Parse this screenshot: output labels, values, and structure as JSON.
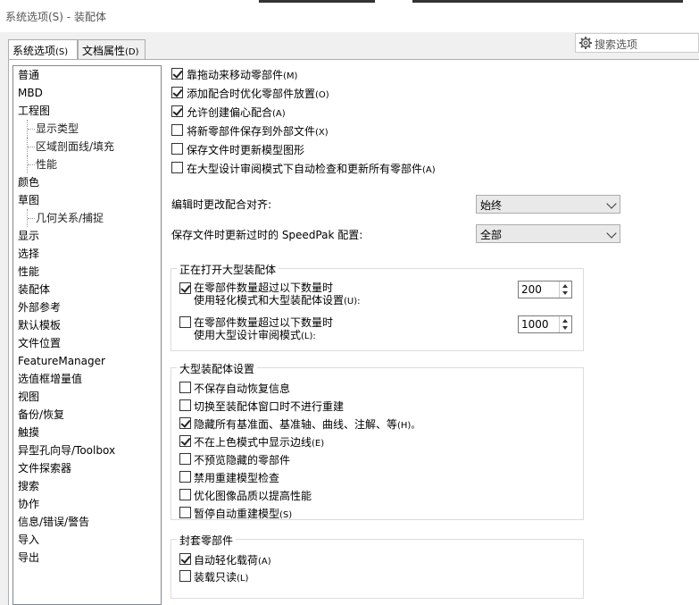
{
  "window": {
    "title": "系统选项(S) - 装配体"
  },
  "search": {
    "placeholder": "搜索选项",
    "icon": "gear-icon"
  },
  "tabs": [
    {
      "label": "系统选项",
      "shortcut": "(S)",
      "active": true
    },
    {
      "label": "文档属性",
      "shortcut": "(D)",
      "active": false
    }
  ],
  "nav": [
    "普通",
    "MBD",
    "工程图",
    "显示类型",
    "区域剖面线/填充",
    "性能",
    "颜色",
    "草图",
    "几何关系/捕捉",
    "显示",
    "选择",
    "性能",
    "装配体",
    "外部参考",
    "默认模板",
    "文件位置",
    "FeatureManager",
    "选值框增量值",
    "视图",
    "备份/恢复",
    "触摸",
    "异型孔向导/Toolbox",
    "文件探索器",
    "搜索",
    "协作",
    "信息/错误/警告",
    "导入",
    "导出"
  ],
  "options": [
    {
      "label": "靠拖动来移动零部件",
      "key": "(M)",
      "checked": true
    },
    {
      "label": "添加配合时优化零部件放置",
      "key": "(O)",
      "checked": true
    },
    {
      "label": "允许创建偏心配合",
      "key": "(A)",
      "checked": true
    },
    {
      "label": "将新零部件保存到外部文件",
      "key": "(X)",
      "checked": false
    },
    {
      "label": "保存文件时更新模型图形",
      "key": "",
      "checked": false
    },
    {
      "label": "在大型设计审阅模式下自动检查和更新所有零部件",
      "key": "(A)",
      "checked": false
    }
  ],
  "dropdowns": [
    {
      "label": "编辑时更改配合对齐:",
      "value": "始终"
    },
    {
      "label": "保存文件时更新过时的 SpeedPak 配置:",
      "value": "全部"
    }
  ],
  "large_open": {
    "title": "正在打开大型装配体",
    "items": [
      {
        "line1": "在零部件数量超过以下数量时",
        "line2": "使用轻化模式和大型装配体设置",
        "key": "(U):",
        "checked": true,
        "value": "200"
      },
      {
        "line1": "在零部件数量超过以下数量时",
        "line2": "使用大型设计审阅模式",
        "key": "(L):",
        "checked": false,
        "value": "1000"
      }
    ]
  },
  "large_settings": {
    "title": "大型装配体设置",
    "items": [
      {
        "label": "不保存自动恢复信息",
        "key": "",
        "checked": false
      },
      {
        "label": "切换至装配体窗口时不进行重建",
        "key": "",
        "checked": false
      },
      {
        "label": "隐藏所有基准面、基准轴、曲线、注解、等",
        "key": "(H)。",
        "checked": true
      },
      {
        "label": "不在上色模式中显示边线",
        "key": "(E)",
        "checked": true
      },
      {
        "label": "不预览隐藏的零部件",
        "key": "",
        "checked": false
      },
      {
        "label": "禁用重建模型检查",
        "key": "",
        "checked": false
      },
      {
        "label": "优化图像品质以提高性能",
        "key": "",
        "checked": false
      },
      {
        "label": "暂停自动重建模型",
        "key": "(S)",
        "checked": false
      }
    ]
  },
  "envelope": {
    "title": "封套零部件",
    "items": [
      {
        "label": "自动轻化载荷",
        "key": "(A)",
        "checked": true
      },
      {
        "label": "装载只读",
        "key": "(L)",
        "checked": false
      }
    ]
  }
}
